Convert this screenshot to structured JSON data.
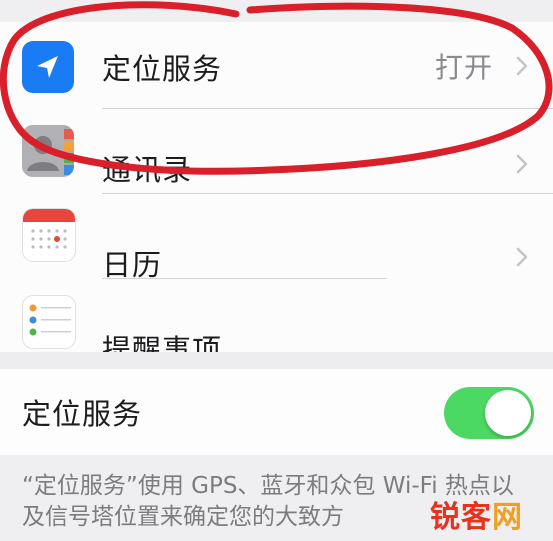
{
  "privacy_list": {
    "items": [
      {
        "label": "定位服务",
        "value": "打开",
        "icon": "location-arrow-icon"
      },
      {
        "label": "通讯录",
        "value": "",
        "icon": "contacts-icon"
      },
      {
        "label": "日历",
        "value": "",
        "icon": "calendar-icon"
      },
      {
        "label": "提醒事项",
        "value": "",
        "icon": "reminders-icon"
      }
    ]
  },
  "location_services": {
    "label": "定位服务",
    "enabled": true,
    "footer": "“定位服务”使用 GPS、蓝牙和众包 Wi-Fi 热点以及信号塔位置来确定您的大致方"
  },
  "watermark": {
    "text_a": "锐客",
    "text_b": "网"
  },
  "colors": {
    "toggle_on": "#4cd963",
    "location_icon_bg": "#1a7cf5",
    "annotation_red": "#d9202a",
    "watermark": "#e7331b"
  }
}
